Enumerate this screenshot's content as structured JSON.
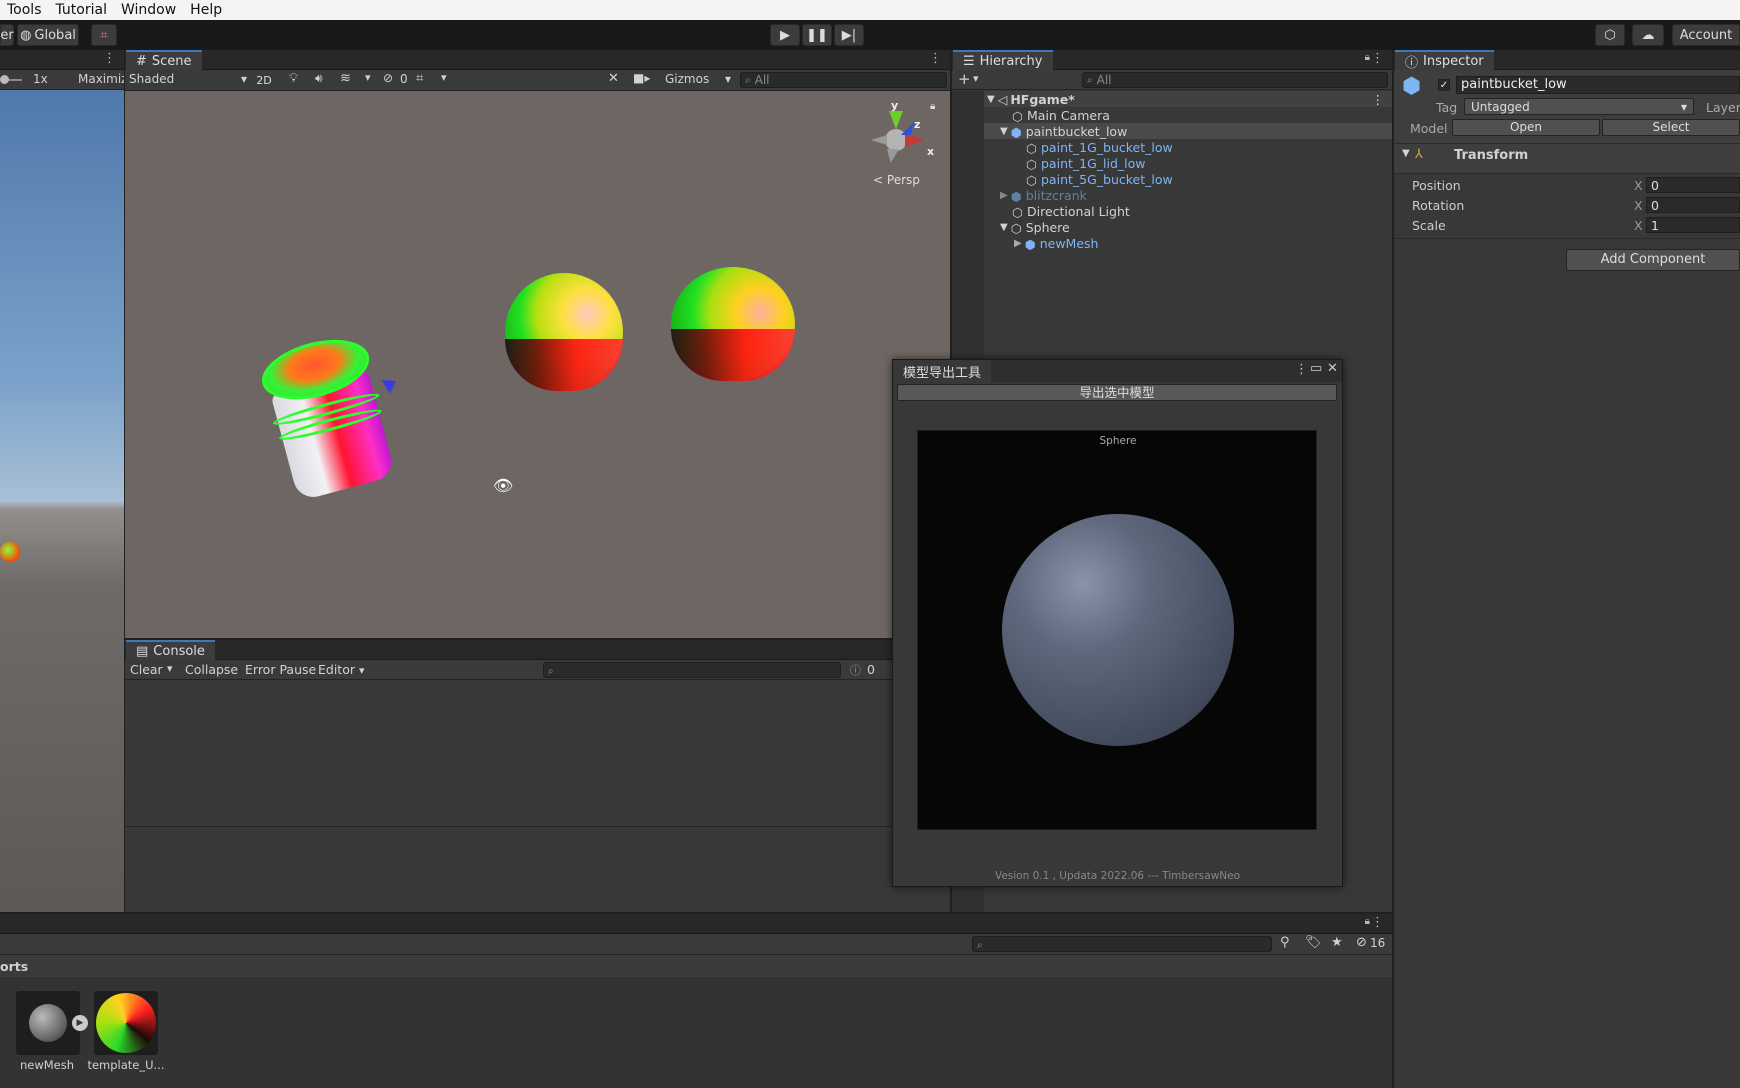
{
  "menu": {
    "items": [
      "Tools",
      "Tutorial",
      "Window",
      "Help"
    ]
  },
  "toolbar": {
    "left_partial": "er",
    "global_label": "Global",
    "account_label": "Account"
  },
  "game_view": {
    "scale_label": "1x",
    "maximize_label": "Maximiz"
  },
  "scene": {
    "tab_label": "Scene",
    "shading_mode": "Shaded",
    "mode_2d": "2D",
    "hidden_count": "0",
    "gizmos_label": "Gizmos",
    "search_placeholder": "All",
    "persp_label": "Persp",
    "axis_y": "y",
    "axis_z": "z",
    "axis_x": "x"
  },
  "console": {
    "tab_label": "Console",
    "clear_label": "Clear",
    "collapse_label": "Collapse",
    "error_pause_label": "Error Pause",
    "editor_label": "Editor",
    "count_label": "0"
  },
  "hierarchy": {
    "tab_label": "Hierarchy",
    "search_placeholder": "All",
    "scene_name": "HFgame*",
    "items": [
      {
        "label": "Main Camera",
        "type": "normal"
      },
      {
        "label": "paintbucket_low",
        "type": "normal"
      },
      {
        "label": "paint_1G_bucket_low",
        "type": "prefab"
      },
      {
        "label": "paint_1G_lid_low",
        "type": "prefab"
      },
      {
        "label": "paint_5G_bucket_low",
        "type": "prefab"
      },
      {
        "label": "blitzcrank",
        "type": "disabled"
      },
      {
        "label": "Directional Light",
        "type": "normal"
      },
      {
        "label": "Sphere",
        "type": "normal"
      },
      {
        "label": "newMesh",
        "type": "prefab"
      }
    ]
  },
  "inspector": {
    "tab_label": "Inspector",
    "object_name": "paintbucket_low",
    "tag_label": "Tag",
    "tag_value": "Untagged",
    "layer_label": "Layer",
    "model_label": "Model",
    "open_label": "Open",
    "select_label": "Select",
    "transform_label": "Transform",
    "rows": [
      {
        "label": "Position",
        "axis": "X",
        "value": "0"
      },
      {
        "label": "Rotation",
        "axis": "X",
        "value": "0"
      },
      {
        "label": "Scale",
        "axis": "X",
        "value": "1"
      }
    ],
    "add_component_label": "Add Component"
  },
  "export_tool": {
    "title": "模型导出工具",
    "export_button_label": "导出选中模型",
    "preview_label": "Sphere",
    "version_text": "Vesion 0.1 , Updata 2022.06 --- TimbersawNeo"
  },
  "project": {
    "breadcrumb_partial": "orts",
    "hidden_count": "16",
    "assets": [
      {
        "label": "newMesh"
      },
      {
        "label": "template_U..."
      }
    ]
  },
  "colors": {
    "scene_bg": "#6e6662",
    "panel_bg": "#383838",
    "accent_blue": "#3a79bb",
    "prefab_text": "#7fb4f5"
  }
}
